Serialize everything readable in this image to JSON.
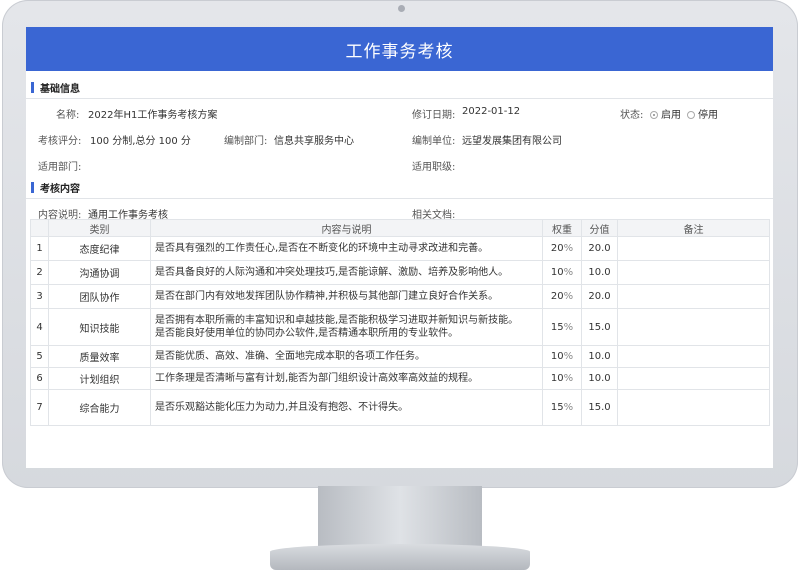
{
  "header": {
    "title": "工作事务考核"
  },
  "basic": {
    "section_title": "基础信息",
    "name_label": "名称:",
    "name_value": "2022年H1工作事务考核方案",
    "revise_label": "修订日期:",
    "revise_value": "2022-01-12",
    "status_label": "状态:",
    "status_enabled": "启用",
    "status_disabled": "停用",
    "score_label": "考核评分:",
    "score_value": "100 分制,总分 100 分",
    "dept_label": "编制部门:",
    "dept_value": "信息共享服务中心",
    "unit_label": "编制单位:",
    "unit_value": "远望发展集团有限公司",
    "apply_dept_label": "适用部门:",
    "apply_level_label": "适用职级:"
  },
  "content": {
    "section_title": "考核内容",
    "desc_label": "内容说明:",
    "desc_value": "通用工作事务考核",
    "doc_label": "相关文档:"
  },
  "table": {
    "headers": [
      "",
      "类别",
      "内容与说明",
      "权重",
      "分值",
      "备注"
    ],
    "rows": [
      {
        "no": "1",
        "category": "态度纪律",
        "desc": [
          "是否具有强烈的工作责任心,是否在不断变化的环境中主动寻求改进和完善。"
        ],
        "weight": "20",
        "pct": "%",
        "score": "20.0",
        "note": ""
      },
      {
        "no": "2",
        "category": "沟通协调",
        "desc": [
          "是否具备良好的人际沟通和冲突处理技巧,是否能谅解、激励、培养及影响他人。"
        ],
        "weight": "10",
        "pct": "%",
        "score": "10.0",
        "note": ""
      },
      {
        "no": "3",
        "category": "团队协作",
        "desc": [
          "是否在部门内有效地发挥团队协作精神,并积极与其他部门建立良好合作关系。"
        ],
        "weight": "20",
        "pct": "%",
        "score": "20.0",
        "note": ""
      },
      {
        "no": "4",
        "category": "知识技能",
        "desc": [
          "是否拥有本职所需的丰富知识和卓越技能,是否能积极学习进取并新知识与新技能。",
          "是否能良好使用单位的协同办公软件,是否精通本职所用的专业软件。"
        ],
        "weight": "15",
        "pct": "%",
        "score": "15.0",
        "note": ""
      },
      {
        "no": "5",
        "category": "质量效率",
        "desc": [
          "是否能优质、高效、准确、全面地完成本职的各项工作任务。"
        ],
        "weight": "10",
        "pct": "%",
        "score": "10.0",
        "note": ""
      },
      {
        "no": "6",
        "category": "计划组织",
        "desc": [
          "工作条理是否清晰与富有计划,能否为部门组织设计高效率高效益的规程。"
        ],
        "weight": "10",
        "pct": "%",
        "score": "10.0",
        "note": ""
      },
      {
        "no": "7",
        "category": "综合能力",
        "desc": [
          "是否乐观豁达能化压力为动力,并且没有抱怨、不计得失。"
        ],
        "weight": "15",
        "pct": "%",
        "score": "15.0",
        "note": ""
      }
    ]
  }
}
